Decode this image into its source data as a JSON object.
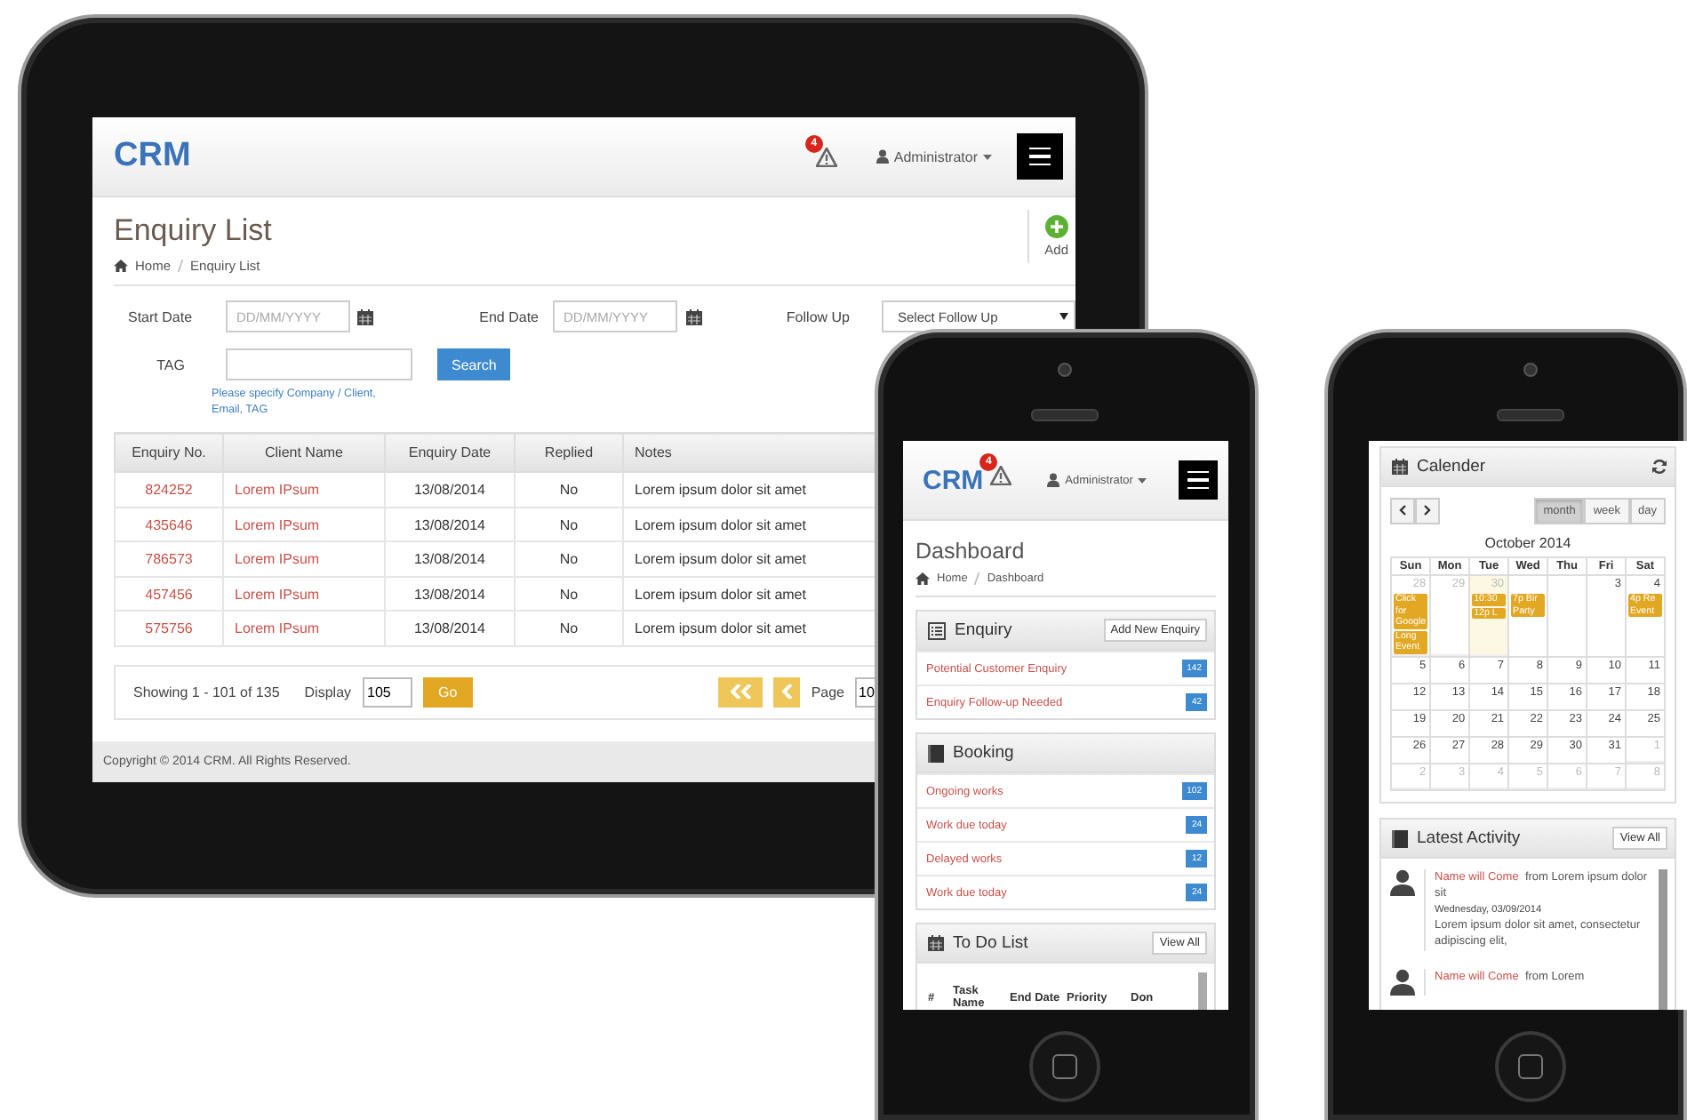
{
  "tablet": {
    "brand": "CRM",
    "alert_count": "4",
    "user": "Administrator",
    "page_title": "Enquiry List",
    "breadcrumb": [
      "Home",
      "Enquiry List"
    ],
    "add_label": "Add",
    "filters": {
      "start_label": "Start Date",
      "start_placeholder": "DD/MM/YYYY",
      "end_label": "End Date",
      "end_placeholder": "DD/MM/YYYY",
      "follow_label": "Follow Up",
      "follow_value": "Select Follow Up",
      "tag_label": "TAG",
      "tag_hint": "Please specify Company / Client, Email, TAG",
      "search": "Search"
    },
    "table": {
      "columns": [
        "Enquiry No.",
        "Client Name",
        "Enquiry Date",
        "Replied",
        "Notes"
      ],
      "rows": [
        [
          "824252",
          "Lorem IPsum",
          "13/08/2014",
          "No",
          "Lorem ipsum dolor sit amet"
        ],
        [
          "435646",
          "Lorem IPsum",
          "13/08/2014",
          "No",
          "Lorem ipsum dolor sit amet"
        ],
        [
          "786573",
          "Lorem IPsum",
          "13/08/2014",
          "No",
          "Lorem ipsum dolor sit amet"
        ],
        [
          "457456",
          "Lorem IPsum",
          "13/08/2014",
          "No",
          "Lorem ipsum dolor sit amet"
        ],
        [
          "575756",
          "Lorem IPsum",
          "13/08/2014",
          "No",
          "Lorem ipsum dolor sit amet"
        ]
      ]
    },
    "pager": {
      "showing": "Showing 1 - 101 of 135",
      "display_label": "Display",
      "display_value": "105",
      "go": "Go",
      "page_label": "Page",
      "page_value": "10"
    },
    "footer": "Copyright © 2014 CRM. All Rights Reserved."
  },
  "phone_dashboard": {
    "brand": "CRM",
    "alert_count": "4",
    "user": "Administrator",
    "page_title": "Dashboard",
    "breadcrumb": [
      "Home",
      "Dashboard"
    ],
    "panels": [
      {
        "kind": "list",
        "title": "Enquiry",
        "action": "Add New Enquiry",
        "items": [
          {
            "label": "Potential Customer Enquiry",
            "count": "142"
          },
          {
            "label": "Enquiry Follow-up Needed",
            "count": "42"
          }
        ]
      },
      {
        "kind": "list",
        "title": "Booking",
        "items": [
          {
            "label": "Ongoing works",
            "count": "102"
          },
          {
            "label": "Work due today",
            "count": "24"
          },
          {
            "label": "Delayed works",
            "count": "12"
          },
          {
            "label": "Work due today",
            "count": "24"
          }
        ]
      },
      {
        "kind": "table",
        "title": "To Do List",
        "action": "View All",
        "columns": [
          "#",
          "Task Name",
          "End Date",
          "Priority",
          "Don"
        ]
      }
    ]
  },
  "phone_calendar": {
    "calendar": {
      "title": "Calender",
      "views": [
        {
          "label": "month",
          "selected": true
        },
        {
          "label": "week",
          "selected": false
        },
        {
          "label": "day",
          "selected": false
        }
      ],
      "month_title": "October 2014",
      "weekdays": [
        "Sun",
        "Mon",
        "Tue",
        "Wed",
        "Thu",
        "Fri",
        "Sat"
      ],
      "weeks": [
        [
          {
            "day": "28",
            "other_month": true,
            "today": false,
            "events": [
              "Click for Google",
              "Long Event"
            ]
          },
          {
            "day": "29",
            "other_month": true,
            "today": false
          },
          {
            "day": "30",
            "other_month": true,
            "today": true,
            "events": [
              "10:30",
              "12p L"
            ]
          },
          {
            "other_month": false,
            "today": false,
            "events": [
              "7p Bir Party"
            ]
          },
          {
            "other_month": false,
            "today": false
          },
          {
            "day": "3",
            "other_month": false,
            "today": false
          },
          {
            "day": "4",
            "other_month": false,
            "today": false,
            "events": [
              "4p Re Event"
            ]
          }
        ],
        [
          {
            "day": "5",
            "other_month": false,
            "today": false
          },
          {
            "day": "6",
            "other_month": false,
            "today": false
          },
          {
            "day": "7",
            "other_month": false,
            "today": false
          },
          {
            "day": "8",
            "other_month": false,
            "today": false
          },
          {
            "day": "9",
            "other_month": false,
            "today": false
          },
          {
            "day": "10",
            "other_month": false,
            "today": false
          },
          {
            "day": "11",
            "other_month": false,
            "today": false
          }
        ],
        [
          {
            "day": "12",
            "other_month": false,
            "today": false
          },
          {
            "day": "13",
            "other_month": false,
            "today": false
          },
          {
            "day": "14",
            "other_month": false,
            "today": false
          },
          {
            "day": "15",
            "other_month": false,
            "today": false
          },
          {
            "day": "16",
            "other_month": false,
            "today": false
          },
          {
            "day": "17",
            "other_month": false,
            "today": false
          },
          {
            "day": "18",
            "other_month": false,
            "today": false
          }
        ],
        [
          {
            "day": "19",
            "other_month": false,
            "today": false
          },
          {
            "day": "20",
            "other_month": false,
            "today": false
          },
          {
            "day": "21",
            "other_month": false,
            "today": false
          },
          {
            "day": "22",
            "other_month": false,
            "today": false
          },
          {
            "day": "23",
            "other_month": false,
            "today": false
          },
          {
            "day": "24",
            "other_month": false,
            "today": false
          },
          {
            "day": "25",
            "other_month": false,
            "today": false
          }
        ],
        [
          {
            "day": "26",
            "other_month": false,
            "today": false
          },
          {
            "day": "27",
            "other_month": false,
            "today": false
          },
          {
            "day": "28",
            "other_month": false,
            "today": false
          },
          {
            "day": "29",
            "other_month": false,
            "today": false
          },
          {
            "day": "30",
            "other_month": false,
            "today": false
          },
          {
            "day": "31",
            "other_month": false,
            "today": false
          },
          {
            "day": "1",
            "other_month": true,
            "today": false
          }
        ],
        [
          {
            "day": "2",
            "other_month": true,
            "today": false
          },
          {
            "day": "3",
            "other_month": true,
            "today": false
          },
          {
            "day": "4",
            "other_month": true,
            "today": false
          },
          {
            "day": "5",
            "other_month": true,
            "today": false
          },
          {
            "day": "6",
            "other_month": true,
            "today": false
          },
          {
            "day": "7",
            "other_month": true,
            "today": false
          },
          {
            "day": "8",
            "other_month": true,
            "today": false
          }
        ]
      ]
    },
    "activity": {
      "title": "Latest Activity",
      "action": "View All",
      "items": [
        {
          "name": "Name will Come",
          "text": "from Lorem ipsum dolor sit",
          "date": "Wednesday, 03/09/2014",
          "body": "Lorem ipsum dolor sit amet, consectetur adipiscing elit,"
        },
        {
          "name": "Name will Come",
          "text": "from Lorem"
        }
      ]
    }
  }
}
